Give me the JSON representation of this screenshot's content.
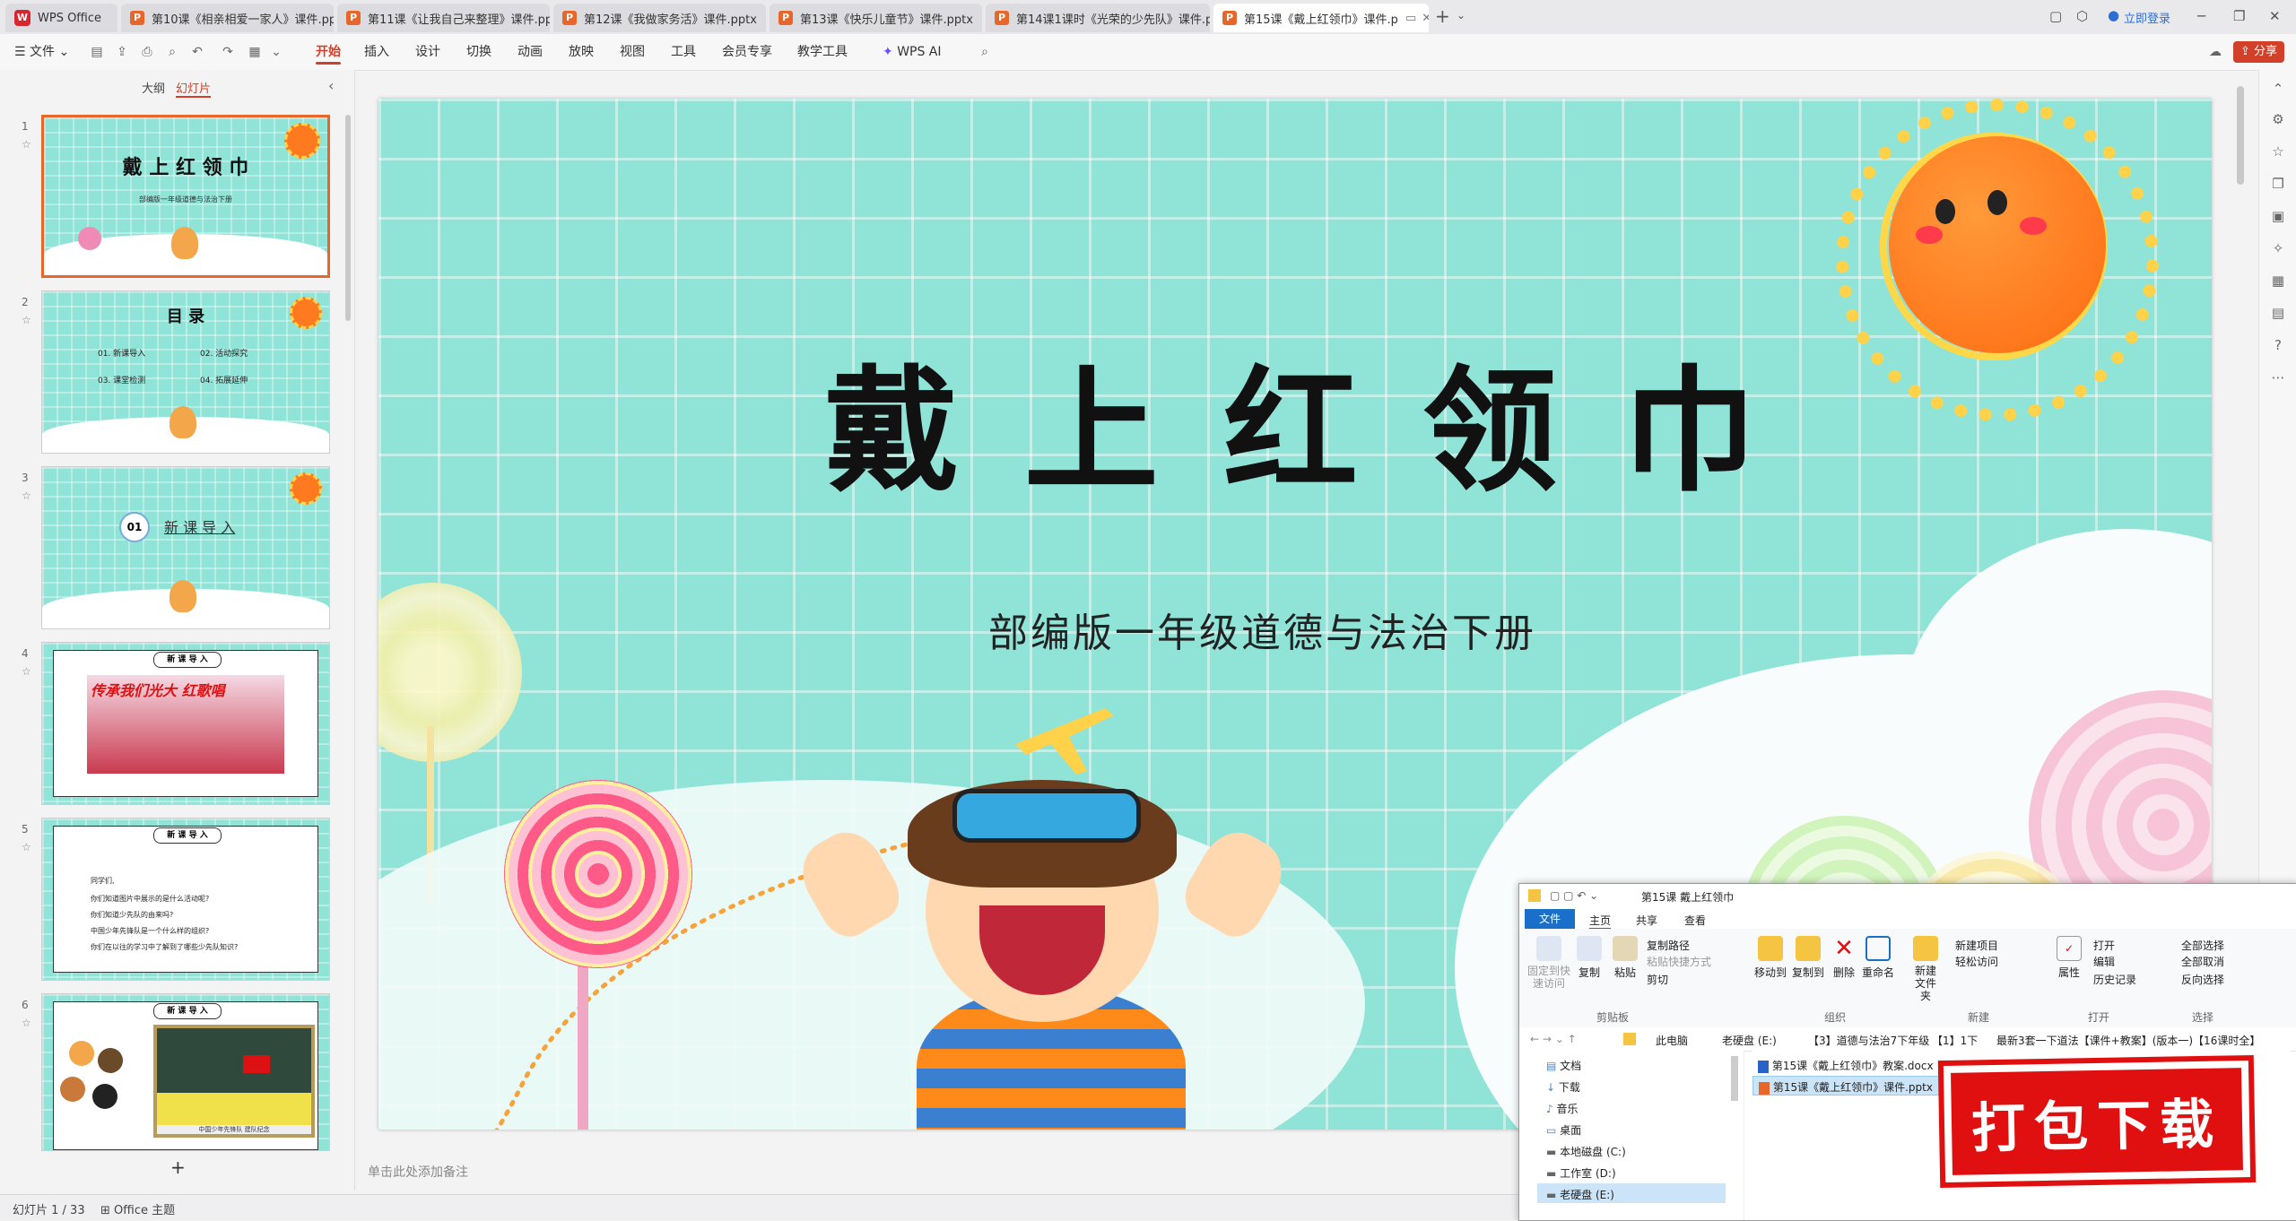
{
  "tabs": [
    {
      "label": "WPS Office",
      "kind": "home"
    },
    {
      "label": "第10课《相亲相爱一家人》课件.pptx",
      "kind": "ppt"
    },
    {
      "label": "第11课《让我自己来整理》课件.pptx",
      "kind": "ppt"
    },
    {
      "label": "第12课《我做家务活》课件.pptx",
      "kind": "ppt"
    },
    {
      "label": "第13课《快乐儿童节》课件.pptx",
      "kind": "ppt"
    },
    {
      "label": "第14课1课时《光荣的少先队》课件.p",
      "kind": "ppt"
    },
    {
      "label": "第15课《戴上红领巾》课件.p",
      "kind": "ppt",
      "active": true
    }
  ],
  "titlebar": {
    "login": "立即登录",
    "add_tab": "+"
  },
  "menubar": {
    "file": "文件",
    "items": [
      "开始",
      "插入",
      "设计",
      "切换",
      "动画",
      "放映",
      "视图",
      "工具",
      "会员专享",
      "教学工具"
    ],
    "active": "开始",
    "wps_ai": "WPS AI",
    "share": "分享"
  },
  "panel": {
    "tab_outline": "大纲",
    "tab_slides": "幻灯片",
    "add": "+",
    "thumbs": [
      {
        "num": "1",
        "title": "戴 上 红 领 巾",
        "subtitle": "部编版一年级道德与法治下册"
      },
      {
        "num": "2",
        "title": "目 录",
        "items": [
          "01. 新课导入",
          "02. 活动探究",
          "03. 课堂检测",
          "04. 拓展延伸"
        ]
      },
      {
        "num": "3",
        "badge": "01",
        "title": "新 课 导 入"
      },
      {
        "num": "4",
        "header": "新 课 导 入",
        "banner": "传承我们光大 红歌唱"
      },
      {
        "num": "5",
        "header": "新 课 导 入",
        "lines": [
          "同学们,",
          "你们知道图片中展示的是什么活动呢?",
          "你们知道少先队的由来吗?",
          "中国少年先锋队是一个什么样的组织?",
          "你们在以往的学习中了解到了哪些少先队知识?"
        ]
      },
      {
        "num": "6",
        "header": "新 课 导 入",
        "caption": "中国少年先锋队 建队纪念"
      }
    ]
  },
  "slide": {
    "title": "戴 上 红 领 巾",
    "subtitle": "部编版一年级道德与法治下册"
  },
  "notes_placeholder": "单击此处添加备注",
  "status": {
    "slide_count": "幻灯片 1 / 33",
    "theme": "Office 主题"
  },
  "explorer": {
    "title": "第15课 戴上红领巾",
    "ribbon_tabs": [
      "文件",
      "主页",
      "共享",
      "查看"
    ],
    "groups": [
      "剪贴板",
      "组织",
      "新建",
      "打开",
      "选择"
    ],
    "buttons": {
      "pin": "固定到快速访问",
      "copy": "复制",
      "paste": "粘贴",
      "copy_path": "复制路径",
      "paste_shortcut": "粘贴快捷方式",
      "cut": "剪切",
      "move_to": "移动到",
      "copy_to": "复制到",
      "delete": "删除",
      "rename": "重命名",
      "new_folder": "新建文件夹",
      "new_item": "新建项目",
      "easy_access": "轻松访问",
      "properties": "属性",
      "open": "打开",
      "edit": "编辑",
      "history": "历史记录",
      "select_all": "全部选择",
      "select_none": "全部取消",
      "invert": "反向选择"
    },
    "path": [
      "此电脑",
      "老硬盘 (E:)",
      "【3】道德与法治7下年级",
      "【1】1下",
      "最新3套一下道法【课件+教案】(版本一)【16课时全】"
    ],
    "tree": [
      "文档",
      "下载",
      "音乐",
      "桌面",
      "本地磁盘 (C:)",
      "工作室 (D:)",
      "老硬盘 (E:)"
    ],
    "files": [
      "第15课《戴上红领巾》教案.docx",
      "第15课《戴上红领巾》课件.pptx"
    ]
  },
  "download_stamp": "打包下载",
  "colors": {
    "accent": "#d2402a",
    "slide_bg": "#8fe3d7",
    "ppt_icon": "#e8662a",
    "sun": "#ff7a1f",
    "stamp": "#e01010"
  }
}
